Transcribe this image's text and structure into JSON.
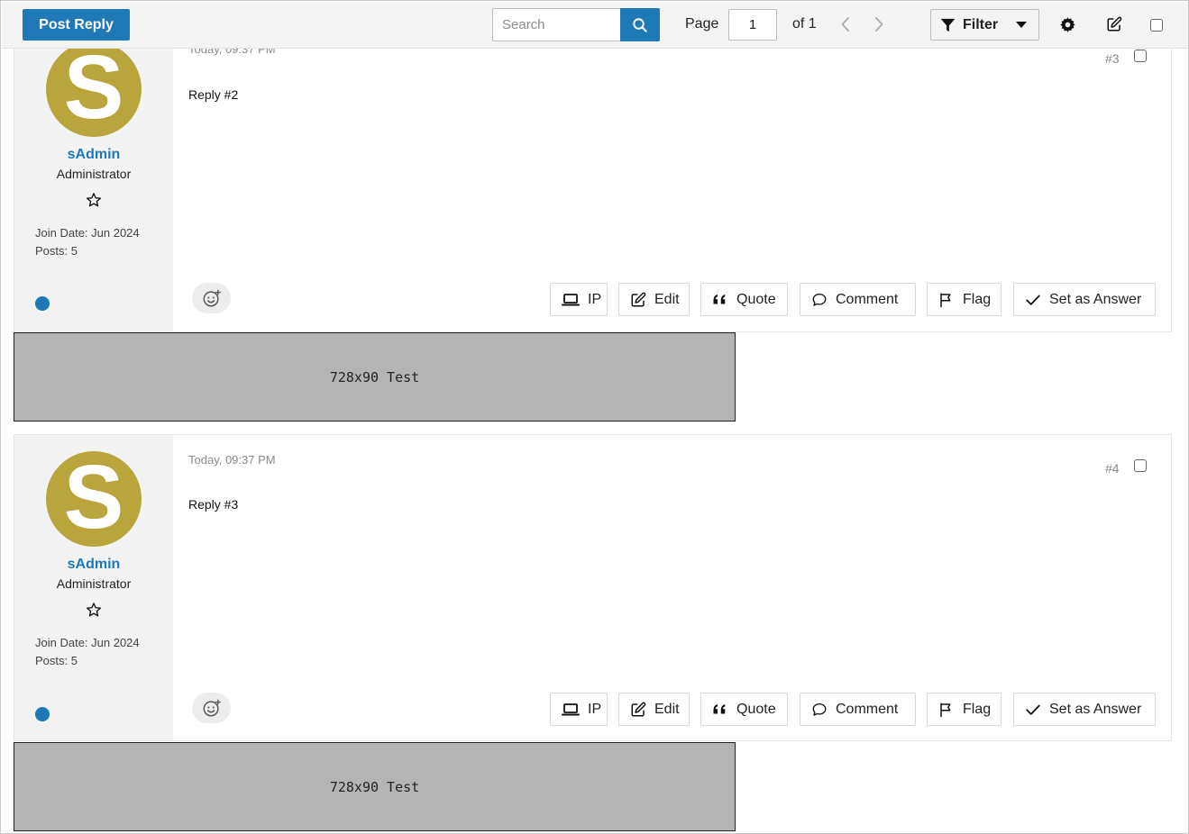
{
  "toolbar": {
    "post_reply_label": "Post Reply",
    "search_placeholder": "Search",
    "page_label": "Page",
    "page_value": "1",
    "of_label": "of 1",
    "filter_label": "Filter"
  },
  "posts": [
    {
      "avatar_letter": "S",
      "username": "sAdmin",
      "role": "Administrator",
      "join_date": "Join Date: Jun 2024",
      "posts_count": "Posts: 5",
      "date": "Today, 09:37 PM",
      "number": "#3",
      "body": "Reply #2"
    },
    {
      "avatar_letter": "S",
      "username": "sAdmin",
      "role": "Administrator",
      "join_date": "Join Date: Jun 2024",
      "posts_count": "Posts: 5",
      "date": "Today, 09:37 PM",
      "number": "#4",
      "body": "Reply #3"
    }
  ],
  "actions": {
    "ip": "IP",
    "edit": "Edit",
    "quote": "Quote",
    "comment": "Comment",
    "flag": "Flag",
    "answer": "Set as Answer"
  },
  "ads": [
    "728x90 Test",
    "728x90 Test"
  ],
  "colors": {
    "accent": "#1f79b7",
    "avatar": "#b9a53b",
    "sidebar_bg": "#f3f3f3",
    "ad_bg": "#b4b4b4"
  }
}
